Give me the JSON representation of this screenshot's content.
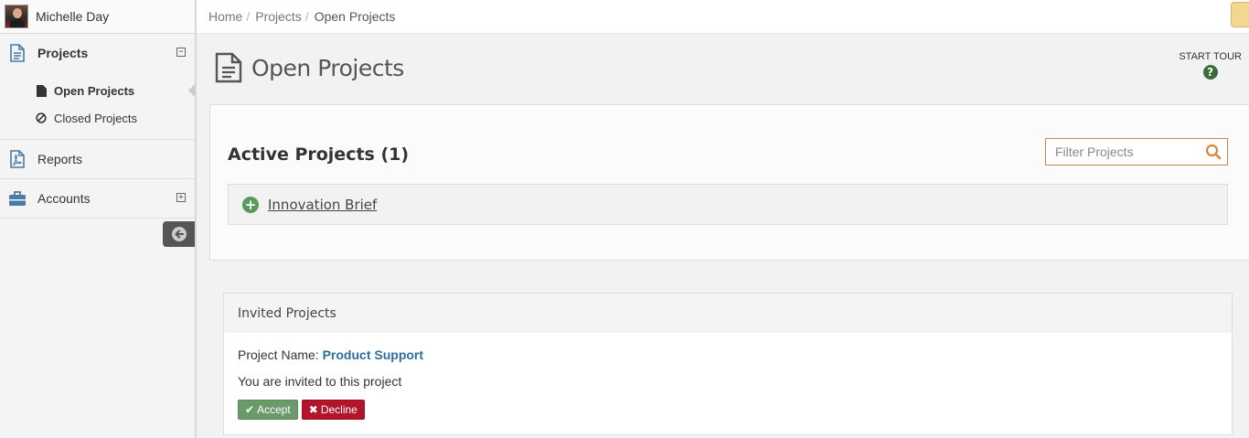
{
  "user": {
    "name": "Michelle Day"
  },
  "sidebar": {
    "projects": {
      "label": "Projects",
      "toggle": "⊟",
      "items": [
        {
          "label": "Open Projects"
        },
        {
          "label": "Closed Projects"
        }
      ]
    },
    "reports": {
      "label": "Reports"
    },
    "accounts": {
      "label": "Accounts",
      "toggle": "⊞"
    }
  },
  "breadcrumb": {
    "home": "Home",
    "projects": "Projects",
    "current": "Open Projects",
    "sep": "/"
  },
  "page": {
    "title": "Open Projects",
    "tour_label": "START TOUR"
  },
  "active": {
    "title": "Active Projects (1)",
    "filter_placeholder": "Filter Projects",
    "projects": [
      {
        "name": "Innovation Brief"
      }
    ]
  },
  "invited": {
    "title": "Invited Projects",
    "name_label": "Project Name:",
    "project_name": "Product Support",
    "message": "You are invited to this project",
    "accept_label": "Accept",
    "decline_label": "Decline"
  },
  "colors": {
    "accept": "#6a9a6a",
    "decline": "#b3142a",
    "link": "#2f6da0",
    "filter_border": "#c8874a"
  }
}
